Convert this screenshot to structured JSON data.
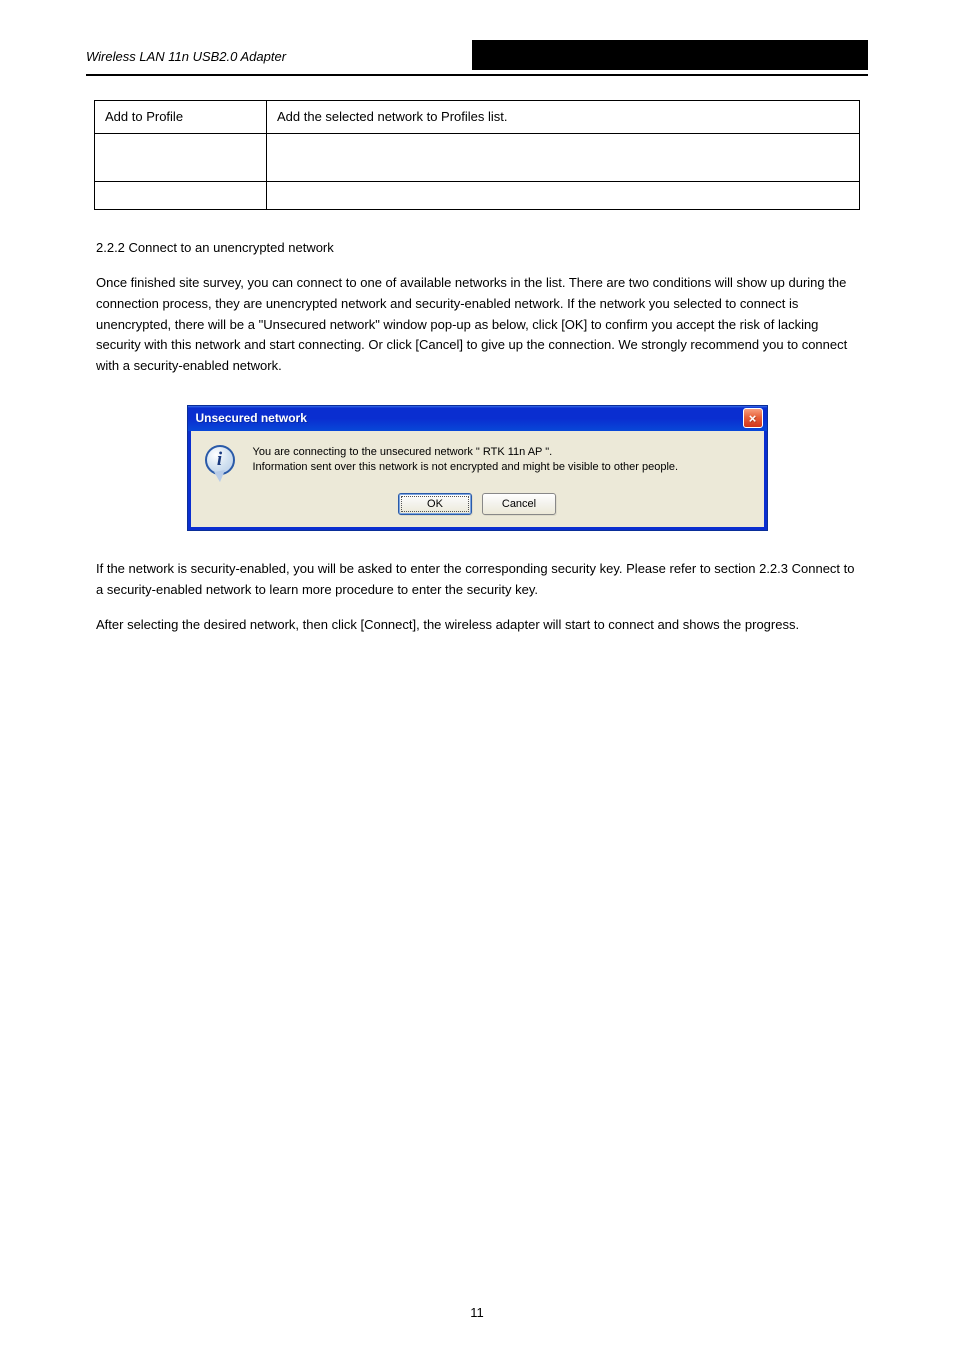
{
  "header": {
    "left": "Wireless LAN 11n USB2.0 Adapter",
    "right_blackbar": true
  },
  "table": {
    "rows": [
      {
        "l": "Add to Profile",
        "r": "Add the selected network to Profiles list."
      },
      {
        "l": "",
        "r": ""
      },
      {
        "l": "",
        "r": ""
      }
    ]
  },
  "paragraphs": {
    "p1": "2.2.2 Connect to an unencrypted network",
    "p2": "Once finished site survey, you can connect to one of available networks in the list. There are two conditions will show up during the connection process, they are unencrypted network and security-enabled network. If the network you selected to connect is unencrypted, there will be a \"Unsecured network\" window pop-up as below, click [OK] to confirm you accept the risk of lacking security with this network and start connecting. Or click [Cancel] to give up the connection. We strongly recommend you to connect with a security-enabled network."
  },
  "dialog": {
    "title": "Unsecured network",
    "close_label": "×",
    "msg_line1": "You are connecting to the unsecured network \" RTK 11n AP \".",
    "msg_line2": " Information sent over this network is not encrypted and might be visible to other people.",
    "ok": "OK",
    "cancel": "Cancel"
  },
  "after_dialog": {
    "p1": "If the network is security-enabled, you will be asked to enter the corresponding security key. Please refer to section 2.2.3 Connect to a security-enabled network to learn more procedure to enter the security key.",
    "p2": "After selecting the desired network, then click [Connect], the wireless adapter will start to connect and shows the progress."
  },
  "page_number": "11"
}
